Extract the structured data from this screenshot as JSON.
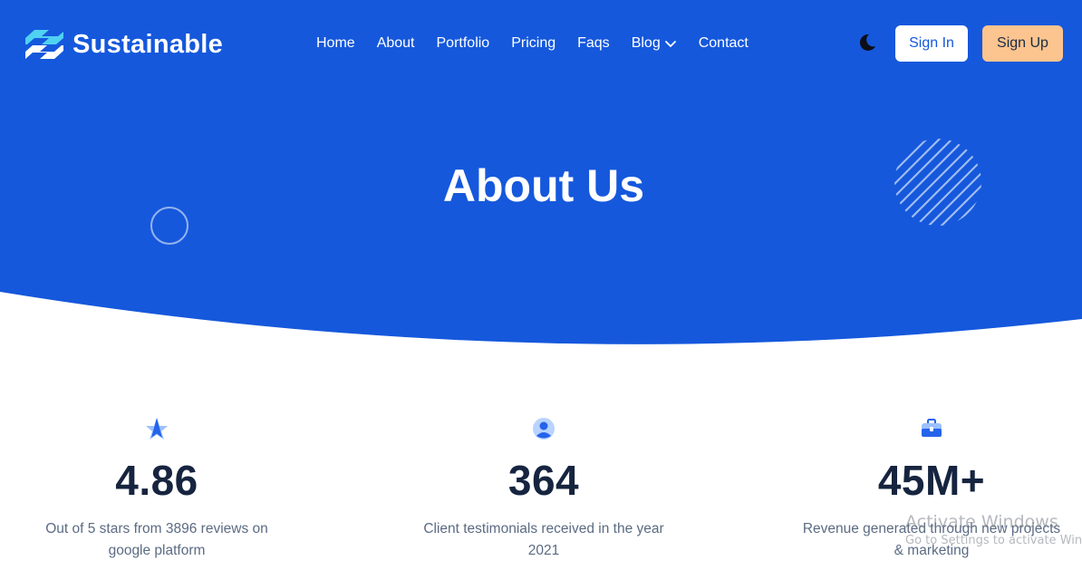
{
  "brand": {
    "name": "Sustainable",
    "icon": "sustainable-logo-icon"
  },
  "nav": {
    "items": [
      {
        "label": "Home"
      },
      {
        "label": "About"
      },
      {
        "label": "Portfolio"
      },
      {
        "label": "Pricing"
      },
      {
        "label": "Faqs"
      },
      {
        "label": "Blog",
        "icon": "chevron-down-icon"
      },
      {
        "label": "Contact"
      }
    ],
    "theme_toggle_icon": "moon-icon",
    "sign_in": "Sign In",
    "sign_up": "Sign Up"
  },
  "hero": {
    "title": "About Us"
  },
  "stats": [
    {
      "icon": "star-icon",
      "value": "4.86",
      "description": "Out of 5 stars from 3896 reviews on google platform"
    },
    {
      "icon": "user-icon",
      "value": "364",
      "description": "Client testimonials received in the year 2021"
    },
    {
      "icon": "briefcase-icon",
      "value": "45M+",
      "description": "Revenue generated through new projects & marketing"
    }
  ],
  "os_watermark": {
    "title": "Activate Windows",
    "subtitle": "Go to Settings to activate Windows."
  },
  "colors": {
    "primary": "#1558dc",
    "accent_button": "#fcc48f",
    "logo_light": "#4fd1f2",
    "heading_dark": "#16243f",
    "body_text": "#5b6b83"
  }
}
